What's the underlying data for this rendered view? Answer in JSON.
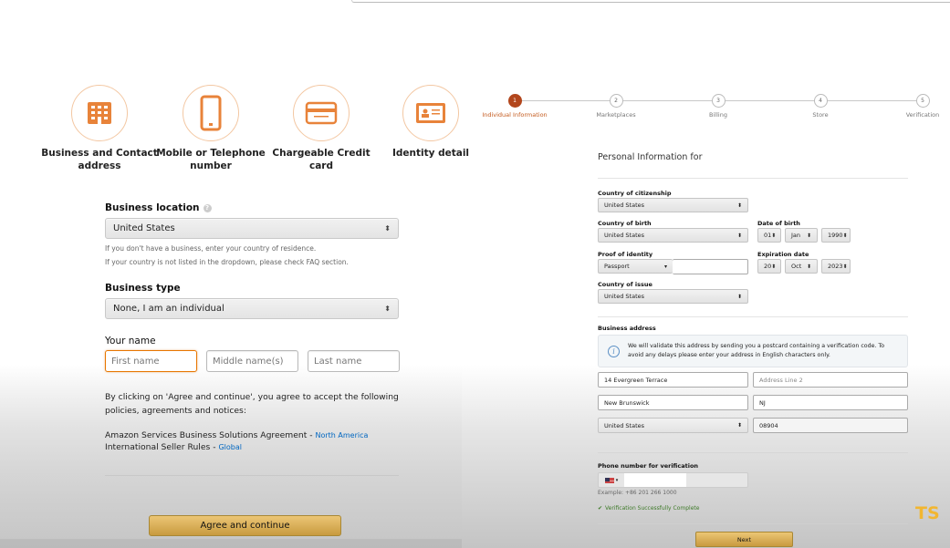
{
  "requirements": [
    {
      "icon": "building-icon",
      "label_line1": "Business and Contact",
      "label_line2": "address"
    },
    {
      "icon": "mobile-phone-icon",
      "label_line1": "Mobile or Telephone",
      "label_line2": "number"
    },
    {
      "icon": "credit-card-icon",
      "label_line1": "Chargeable Credit card",
      "label_line2": ""
    },
    {
      "icon": "id-card-icon",
      "label_line1": "Identity detail",
      "label_line2": ""
    }
  ],
  "left_form": {
    "business_location": {
      "label": "Business location",
      "value": "United States",
      "hint1": "If you don't have a business, enter your country of residence.",
      "hint2": "If your country is not listed in the dropdown, please check FAQ section."
    },
    "business_type": {
      "label": "Business type",
      "value": "None, I am an individual"
    },
    "your_name": {
      "label": "Your name",
      "first_placeholder": "First name",
      "middle_placeholder": "Middle name(s)",
      "last_placeholder": "Last name"
    },
    "policy_text": "By clicking on 'Agree and continue', you agree to accept the following policies, agreements and notices:",
    "agreements": [
      {
        "text": "Amazon Services Business Solutions Agreement - ",
        "link": "North America"
      },
      {
        "text": "International Seller Rules - ",
        "link": "Global"
      }
    ],
    "agree_button": "Agree and continue"
  },
  "stepper": {
    "steps": [
      {
        "number": "1",
        "label": "Individual Information",
        "active": true
      },
      {
        "number": "2",
        "label": "Marketplaces",
        "active": false
      },
      {
        "number": "3",
        "label": "Billing",
        "active": false
      },
      {
        "number": "4",
        "label": "Store",
        "active": false
      },
      {
        "number": "5",
        "label": "Verification",
        "active": false
      }
    ],
    "active_color": "#b2461c"
  },
  "right_form": {
    "title": "Personal Information for",
    "citizenship": {
      "label": "Country of citizenship",
      "value": "United States"
    },
    "birth_country": {
      "label": "Country of birth",
      "value": "United States"
    },
    "dob": {
      "label": "Date of birth",
      "day": "01",
      "month": "Jan",
      "year": "1990"
    },
    "proof": {
      "label": "Proof of identity",
      "value": "Passport"
    },
    "expiration": {
      "label": "Expiration date",
      "day": "20",
      "month": "Oct",
      "year": "2023"
    },
    "issue_country": {
      "label": "Country of issue",
      "value": "United States"
    },
    "business_address": {
      "label": "Business address",
      "info": "We will validate this address by sending you a postcard containing a verification code. To avoid any delays please enter your address in English characters only.",
      "line1": "14 Evergreen Terrace",
      "line2_placeholder": "Address Line 2",
      "city": "New Brunswick",
      "state": "NJ",
      "country": "United States",
      "zip": "08904"
    },
    "phone": {
      "label": "Phone number for verification",
      "example": "Example: +86 201 266 1000",
      "verified": "Verification Successfully Complete"
    },
    "next_button": "Next"
  },
  "watermark": "TS"
}
